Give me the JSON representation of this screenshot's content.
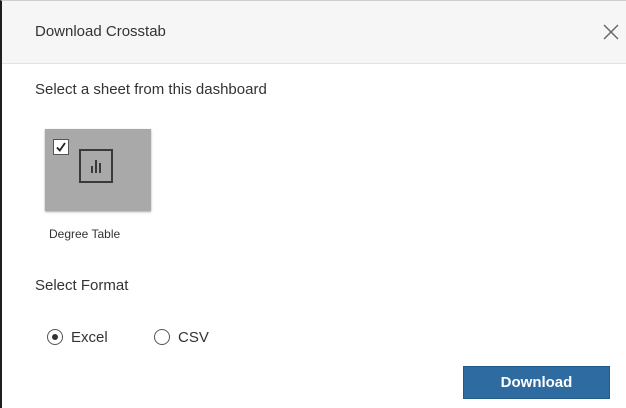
{
  "dialog": {
    "title": "Download Crosstab",
    "close_icon": "close-icon"
  },
  "sheets": {
    "label": "Select a sheet from this dashboard",
    "items": [
      {
        "name": "Degree Table",
        "checked": true,
        "icon": "bar-chart-icon",
        "tile_color": "#a9a9a9"
      }
    ]
  },
  "format": {
    "label": "Select Format",
    "options": [
      {
        "label": "Excel",
        "selected": true
      },
      {
        "label": "CSV",
        "selected": false
      }
    ]
  },
  "actions": {
    "download_label": "Download",
    "download_color": "#2e6ba0"
  }
}
